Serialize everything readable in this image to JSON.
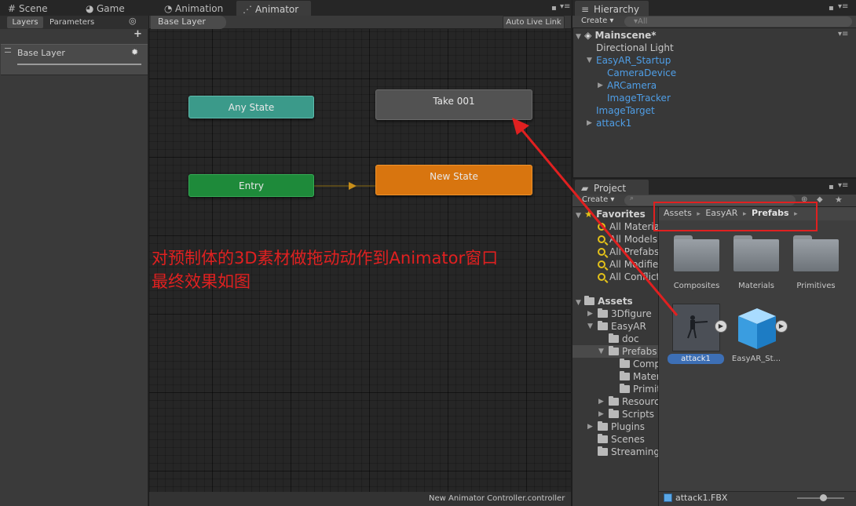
{
  "top_tabs": {
    "scene": "Scene",
    "game": "Game",
    "animation": "Animation",
    "animator": "Animator",
    "hierarchy": "Hierarchy"
  },
  "animator": {
    "left_tabs": {
      "layers": "Layers",
      "parameters": "Parameters"
    },
    "add_symbol": "+",
    "layer_name": "Base Layer",
    "breadcrumb": "Base Layer",
    "auto_live_link": "Auto Live Link",
    "states": {
      "any_state": "Any State",
      "take_001": "Take 001",
      "entry": "Entry",
      "new_state": "New State"
    },
    "footer_path": "New Animator Controller.controller"
  },
  "annotation": {
    "line1": "对预制体的3D素材做拖动动作到Animator窗口",
    "line2": "最终效果如图",
    "color": "#e02020"
  },
  "hierarchy": {
    "create_label": "Create ▾",
    "search_placeholder": "▾All",
    "scene_name": "Mainscene*",
    "items": [
      {
        "label": "Directional Light",
        "blue": false,
        "arrow": ""
      },
      {
        "label": "EasyAR_Startup",
        "blue": true,
        "arrow": "▼"
      },
      {
        "label": "CameraDevice",
        "blue": true,
        "arrow": ""
      },
      {
        "label": "ARCamera",
        "blue": true,
        "arrow": "▶"
      },
      {
        "label": "ImageTracker",
        "blue": true,
        "arrow": ""
      },
      {
        "label": "ImageTarget",
        "blue": true,
        "arrow": ""
      },
      {
        "label": "attack1",
        "blue": true,
        "arrow": "▶"
      }
    ]
  },
  "project": {
    "tab": "Project",
    "create_label": "Create ▾",
    "favorites_label": "Favorites",
    "favorites": [
      "All Materia",
      "All Models",
      "All Prefabs",
      "All Modified",
      "All Conflict"
    ],
    "assets_label": "Assets",
    "tree": [
      {
        "label": "3Dfigure",
        "arrow": "▶"
      },
      {
        "label": "EasyAR",
        "arrow": "▼"
      },
      {
        "label": "doc",
        "arrow": ""
      },
      {
        "label": "Prefabs",
        "arrow": "▼"
      },
      {
        "label": "Comp",
        "arrow": ""
      },
      {
        "label": "Mater",
        "arrow": ""
      },
      {
        "label": "Primit",
        "arrow": ""
      },
      {
        "label": "Resourc",
        "arrow": "▶"
      },
      {
        "label": "Scripts",
        "arrow": "▶"
      },
      {
        "label": "Plugins",
        "arrow": "▶"
      },
      {
        "label": "Scenes",
        "arrow": ""
      },
      {
        "label": "Streaming",
        "arrow": ""
      }
    ],
    "breadcrumb": {
      "a": "Assets",
      "b": "EasyAR",
      "c": "Prefabs",
      "sep": "▸"
    },
    "folders": [
      "Composites",
      "Materials",
      "Primitives"
    ],
    "assets": [
      "attack1",
      "EasyAR_St..."
    ],
    "selected_file": "attack1.FBX"
  },
  "colors": {
    "any_state": "#3b9a8a",
    "entry": "#1e8a3a",
    "new_state": "#d8750f",
    "take": "#525252",
    "highlight": "#e02020",
    "link_blue": "#4f9ee6"
  }
}
